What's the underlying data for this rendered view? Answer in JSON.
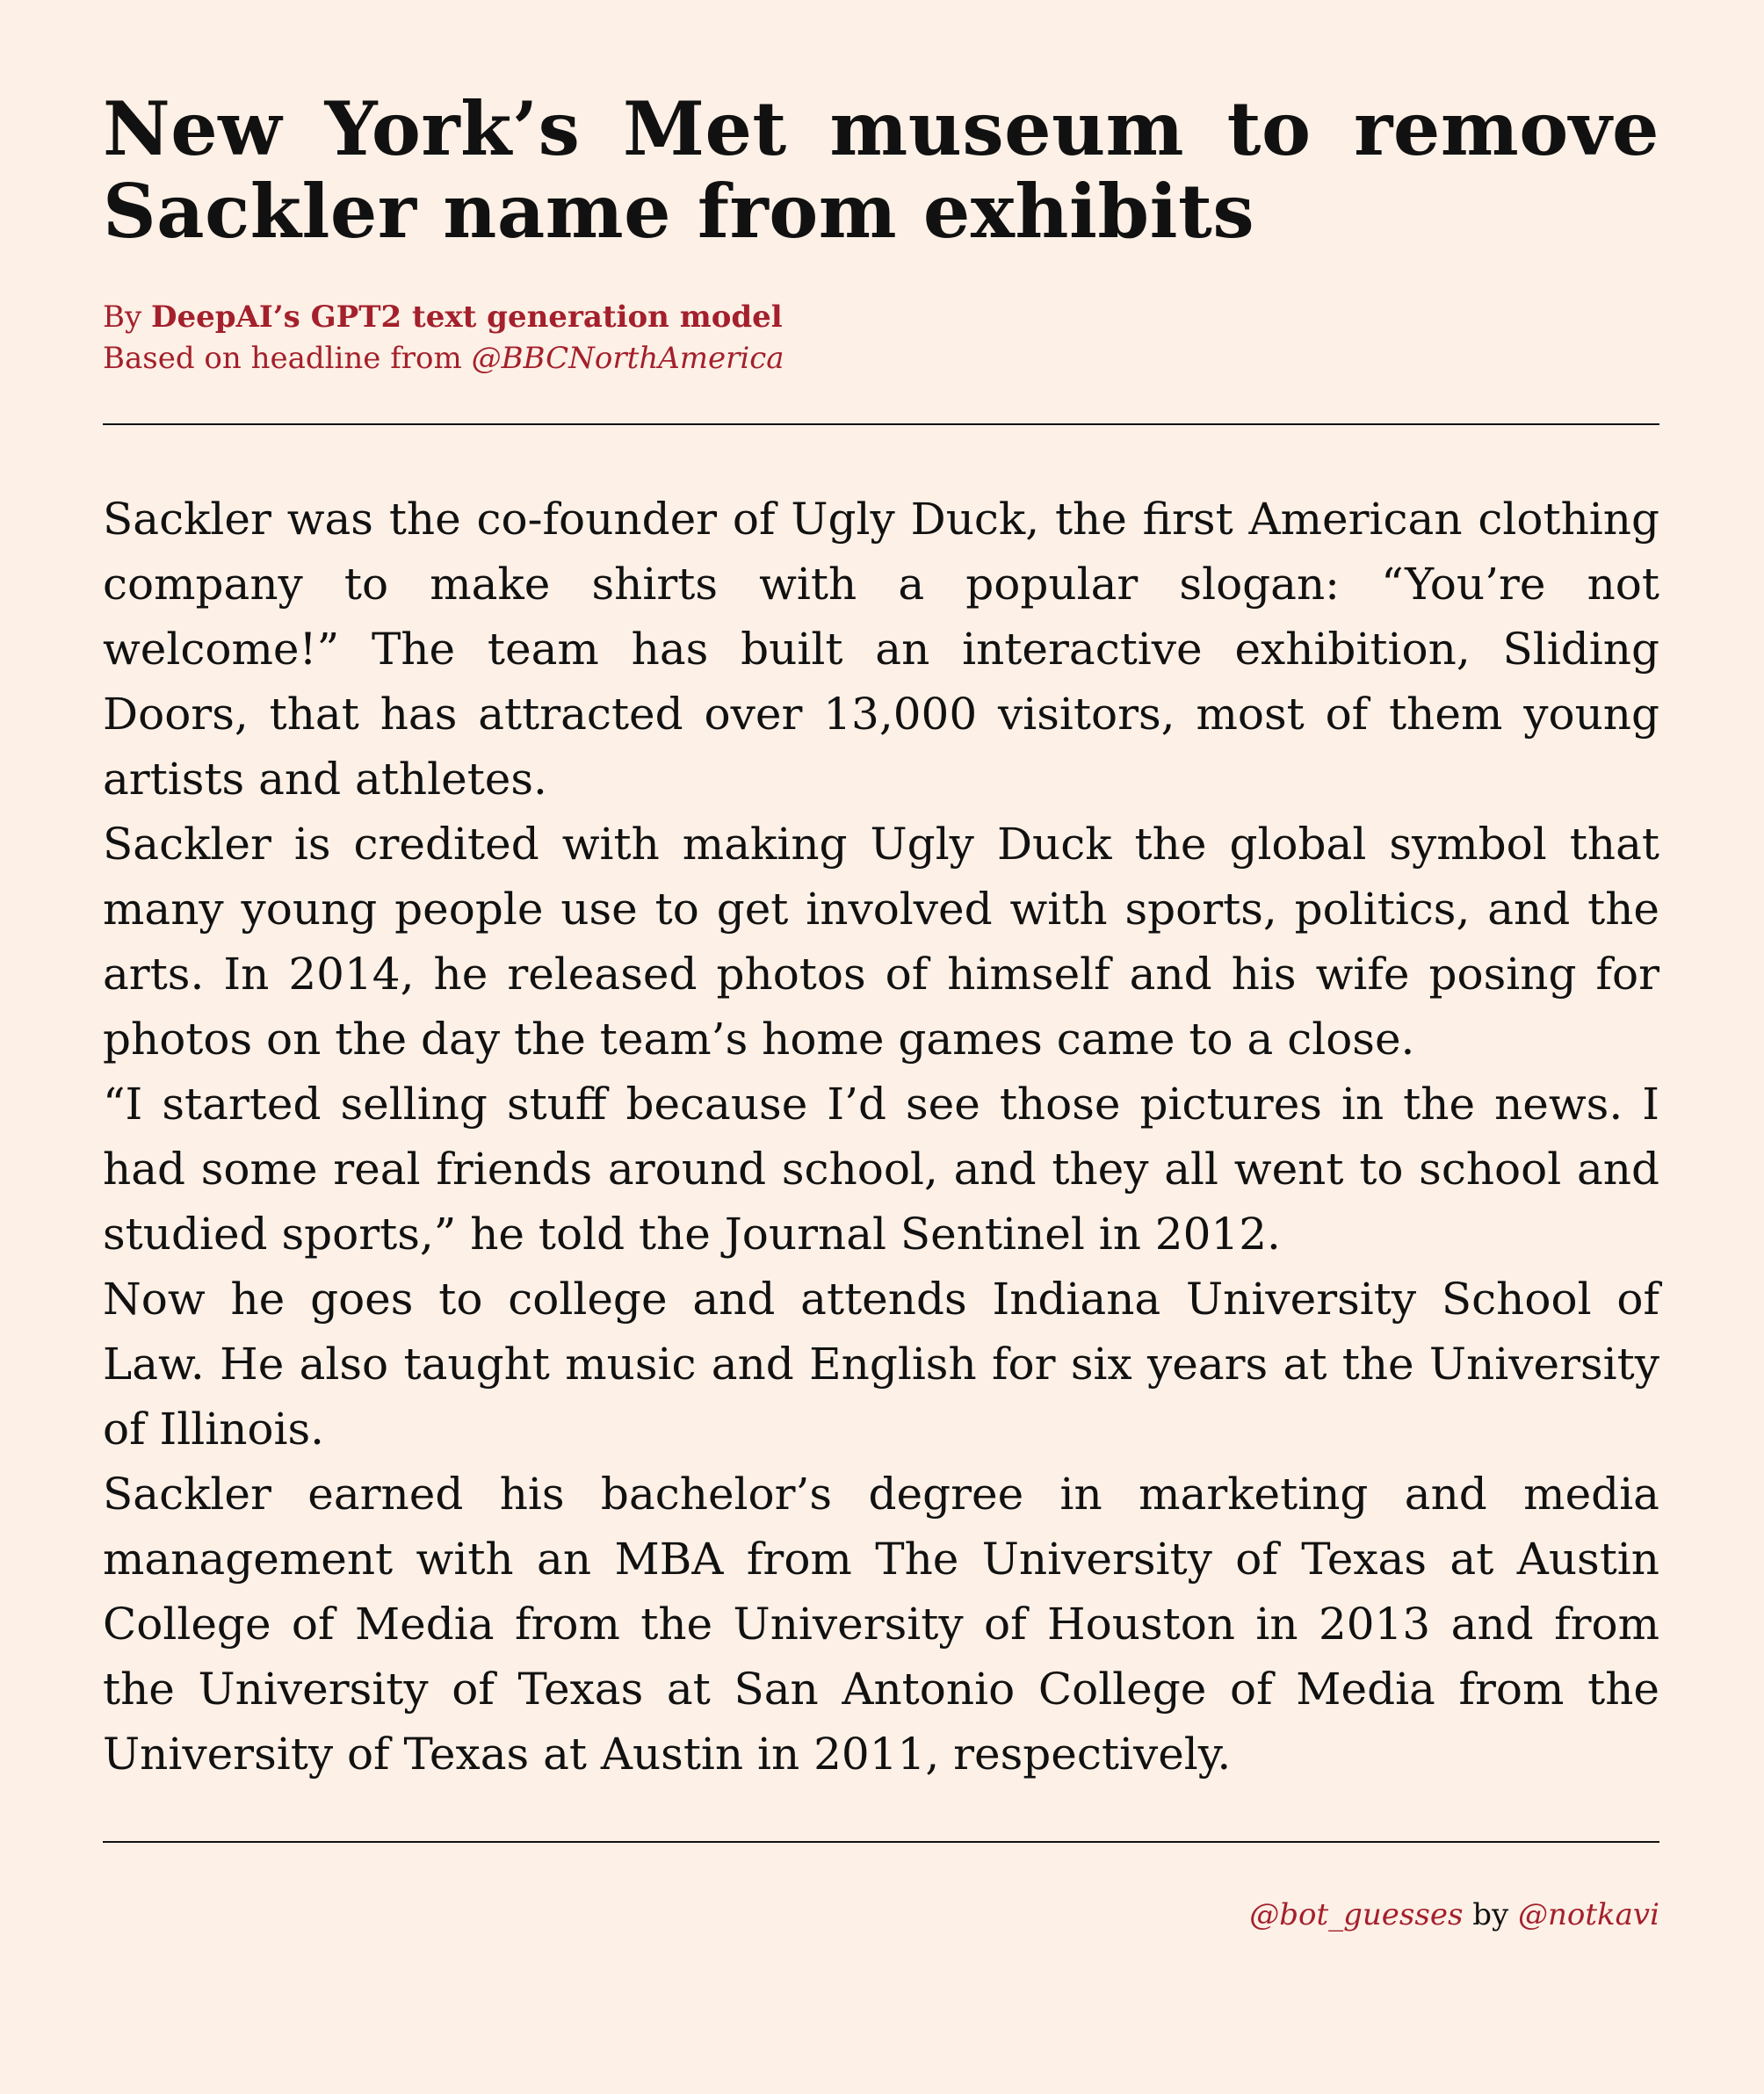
{
  "headline": "New York’s Met museum to remove Sackler name from exhibits",
  "byline": {
    "by_prefix": "By ",
    "author": "DeepAI’s GPT2 text generation model",
    "source_prefix": "Based on headline from ",
    "source_handle": "@BBCNorthAmerica"
  },
  "article": {
    "paragraphs": [
      "Sackler was the co-founder of Ugly Duck, the first American clothing company to make shirts with a popular slogan: “You’re not welcome!” The team has built an interactive exhibition, Sliding Doors, that has attracted over 13,000 visitors, most of them young artists and athletes.",
      "Sackler is credited with making Ugly Duck the global symbol that many young people use to get involved with sports, politics, and the arts. In 2014, he released photos of himself and his wife posing for photos on the day the team’s home games came to a close.",
      "“I started selling stuff because I’d see those pictures in the news. I had some real friends around school, and they all went to school and studied sports,” he told the Journal Sentinel in 2012.",
      "Now he goes to college and attends Indiana University School of Law. He also taught music and English for six years at the University of Illinois.",
      "Sackler earned his bachelor’s degree in marketing and media management with an MBA from The University of Texas at Austin College of Media from the University of Houston in 2013 and from the University of Texas at San Antonio College of Media from the University of Texas at Austin in 2011, respectively."
    ]
  },
  "footer": {
    "bot_handle": "@bot_guesses",
    "by_word": " by ",
    "creator_handle": "@notkavi"
  },
  "colors": {
    "background": "#fdf0e6",
    "accent": "#a3202c",
    "text": "#111111"
  }
}
